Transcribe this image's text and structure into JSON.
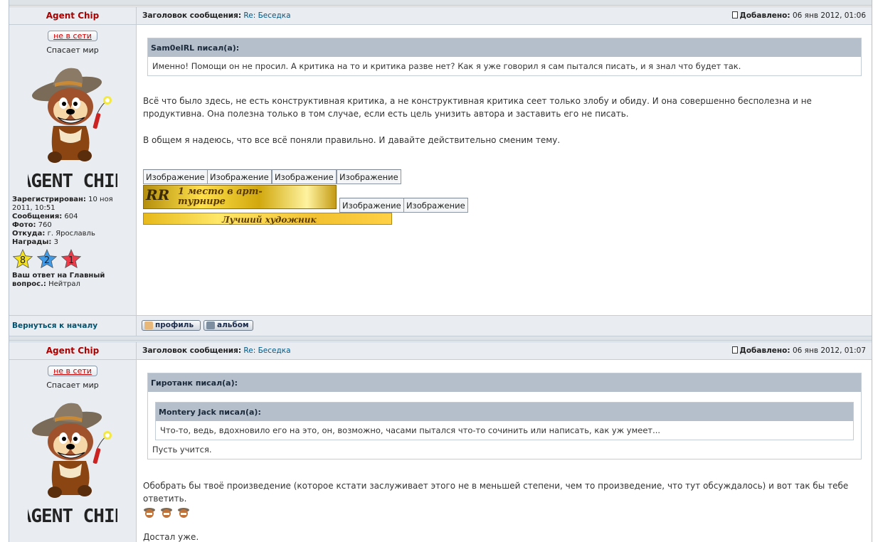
{
  "posts": [
    {
      "author": "Agent Chip",
      "subject_label": "Заголовок сообщения:",
      "subject": "Re: Беседка",
      "added_label": "Добавлено:",
      "added": "06 янв 2012, 01:06",
      "status": "не в сети",
      "rank": "Спасает мир",
      "avatar_text": "AGENT CHIP",
      "info": {
        "registered_label": "Зарегистрирован:",
        "registered": "10 ноя 2011, 10:51",
        "messages_label": "Сообщения:",
        "messages": "604",
        "photos_label": "Фото:",
        "photos": "760",
        "from_label": "Откуда:",
        "from": "г. Ярославль",
        "awards_label": "Награды:",
        "awards": "3",
        "answer_label": "Ваш ответ на Главный вопрос.:",
        "answer": "Нейтрал"
      },
      "stars": [
        {
          "num": "8",
          "color": "#f5e21a"
        },
        {
          "num": "2",
          "color": "#3f9be8"
        },
        {
          "num": "1",
          "color": "#ee3b4a"
        }
      ],
      "quote_author": "Sam0elRL писал(а):",
      "quote_text": "Именно! Помощи он не просил. А критика на то и критика разве нет? Как я уже говорил я сам пытался писать, и я знал что будет так.",
      "para1": "Всё что было здесь, не есть конструктивная критика, а не конструктивная критика сеет только злобу и обиду. И она совершенно бесполезна и не продуктивна. Она полезна только в том случае, если есть цель унизить автора и заставить его не писать.",
      "para2": "В общем я надеюсь, что все всё поняли правильно. И давайте действительно сменим тему.",
      "image_label": "Изображение",
      "banner1_text": "1 место в арт-турнире",
      "banner1_logo": "RR",
      "banner2_text": "Лучший художник",
      "back_link": "Вернуться к началу",
      "profile_button": "профиль",
      "album_button": "альбом"
    },
    {
      "author": "Agent Chip",
      "subject_label": "Заголовок сообщения:",
      "subject": "Re: Беседка",
      "added_label": "Добавлено:",
      "added": "06 янв 2012, 01:07",
      "status": "не в сети",
      "rank": "Спасает мир",
      "avatar_text": "AGENT CHIP",
      "outer_quote_author": "Гиротанк писал(а):",
      "inner_quote_author": "Montery Jack писал(а):",
      "inner_quote_text": "Что-то, ведь, вдохновило его на это, он, возможно, часами пытался что-то сочинить или написать, как уж умеет...",
      "outer_quote_text": "Пусть учится.",
      "para1": "Обобрать бы твоё произведение (которое кстати заслуживает этого не в меньшей степени, чем то произведение, что тут обсуждалось) и вот так бы тебе ответить.",
      "para2": "Достал уже."
    }
  ],
  "colors": {
    "author": "#aa0000",
    "link": "#005784",
    "header_bg": "#e9edf1",
    "quote_head": "#b5bfcb"
  }
}
